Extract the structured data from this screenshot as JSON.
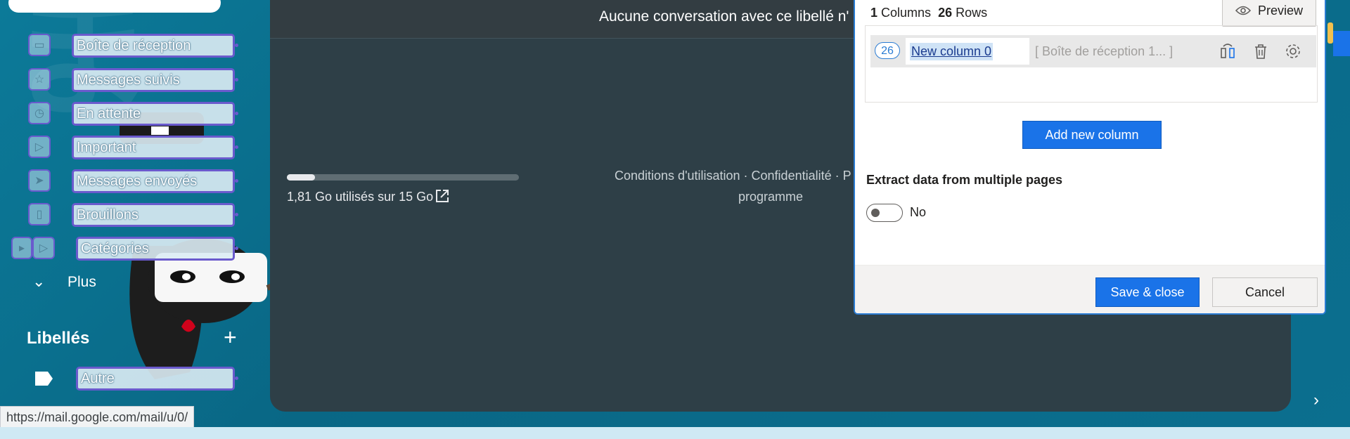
{
  "sidebar": {
    "items": [
      {
        "label": "Boîte de réception",
        "icon": "inbox-icon"
      },
      {
        "label": "Messages suivis",
        "icon": "star-icon"
      },
      {
        "label": "En attente",
        "icon": "clock-icon"
      },
      {
        "label": "Important",
        "icon": "important-icon"
      },
      {
        "label": "Messages envoyés",
        "icon": "send-icon"
      },
      {
        "label": "Brouillons",
        "icon": "draft-icon"
      },
      {
        "label": "Catégories",
        "icon": "label-icon"
      }
    ],
    "more_label": "Plus",
    "labels_heading": "Libellés",
    "labels_items": [
      {
        "label": "Autre"
      }
    ]
  },
  "status_bar": {
    "url": "https://mail.google.com/mail/u/0/"
  },
  "main": {
    "empty_message": "Aucune conversation avec ce libellé n'",
    "storage": {
      "text": "1,81 Go utilisés sur 15 Go",
      "used_fraction": 0.12
    },
    "footer_links_line1": "Conditions d'utilisation · Confidentialité · P",
    "footer_links_line2": "programme"
  },
  "dialog": {
    "columns_count": "1",
    "columns_word": "Columns",
    "rows_count": "26",
    "rows_word": "Rows",
    "preview_label": "Preview",
    "column": {
      "count": "26",
      "name": "New column 0",
      "preview": "[ Boîte de réception 1... ]"
    },
    "add_column_label": "Add new column",
    "extract_title": "Extract data from multiple pages",
    "extract_toggle_text": "No",
    "save_label": "Save & close",
    "cancel_label": "Cancel"
  },
  "colors": {
    "accent": "#1a73e8",
    "selection_outline": "#6a5acd",
    "panel_dark": "#2e3f47"
  }
}
